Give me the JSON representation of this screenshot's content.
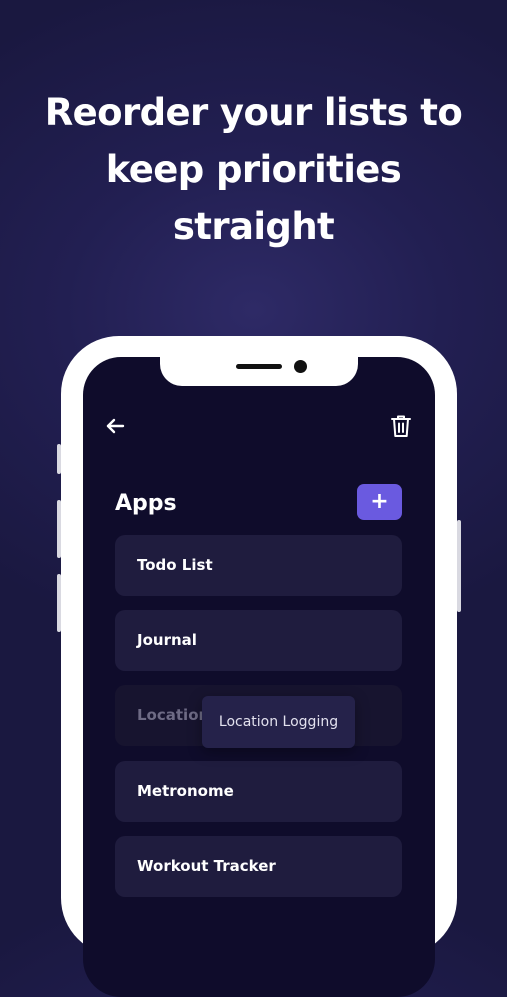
{
  "headline": "Reorder your lists to keep priorities straight",
  "screen": {
    "back_icon": "arrow-left-icon",
    "trash_icon": "trash-icon",
    "section_title": "Apps",
    "add_button_label": "+",
    "items": [
      {
        "label": "Todo List"
      },
      {
        "label": "Journal"
      },
      {
        "label": "Location Logging"
      },
      {
        "label": "Metronome"
      },
      {
        "label": "Workout Tracker"
      }
    ],
    "dragging_label": "Location Logging"
  },
  "colors": {
    "background": "#221f52",
    "screen_background": "#0f0c2b",
    "card_background": "#1f1c3e",
    "accent": "#6a5ae0"
  }
}
